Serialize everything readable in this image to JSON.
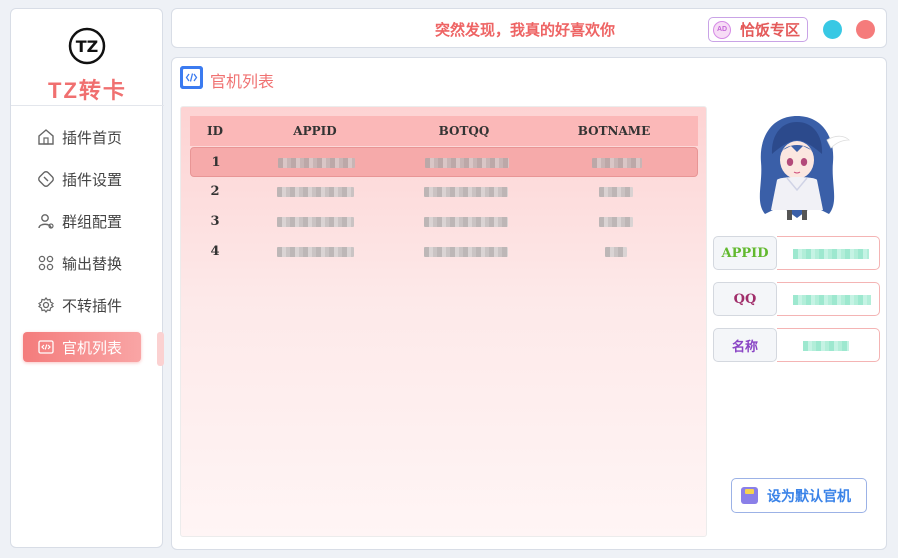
{
  "app": {
    "logo_text": "TZ转卡",
    "logo_mark": "TZ"
  },
  "sidebar": {
    "items": [
      {
        "label": "插件首页",
        "icon": "home-icon",
        "active": false
      },
      {
        "label": "插件设置",
        "icon": "plugin-settings-icon",
        "active": false
      },
      {
        "label": "群组配置",
        "icon": "user-group-icon",
        "active": false
      },
      {
        "label": "输出替换",
        "icon": "grid-icon",
        "active": false
      },
      {
        "label": "不转插件",
        "icon": "gear-icon",
        "active": false
      },
      {
        "label": "官机列表",
        "icon": "code-icon",
        "active": true
      }
    ]
  },
  "topbar": {
    "banner": "突然发现，我真的好喜欢你",
    "ad_label": "恰饭专区",
    "ad_icon_text": "AD"
  },
  "main": {
    "title": "官机列表",
    "table": {
      "columns": [
        "ID",
        "APPID",
        "BOTQQ",
        "BOTNAME"
      ],
      "rows": [
        {
          "id": "1",
          "selected": true
        },
        {
          "id": "2",
          "selected": false
        },
        {
          "id": "3",
          "selected": false
        },
        {
          "id": "4",
          "selected": false
        }
      ]
    },
    "info": {
      "appid_label": "APPID",
      "qq_label": "QQ",
      "name_label": "名称"
    },
    "set_default_label": "设为默认官机"
  },
  "colors": {
    "accent": "#f07272",
    "active_nav": "#f47c7c",
    "header_row": "#fbb8b8",
    "selected_row": "#f6aaaa",
    "btn_blue": "#3a83e8"
  }
}
